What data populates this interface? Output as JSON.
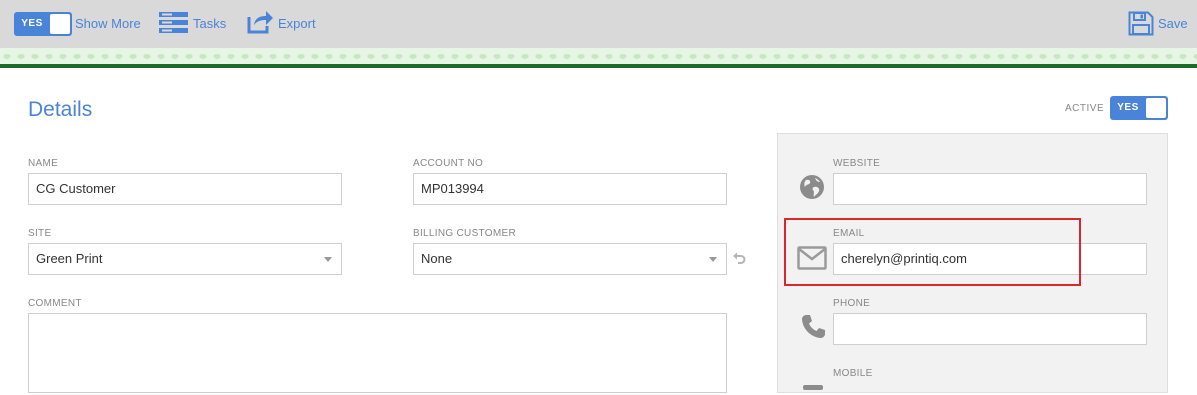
{
  "toolbar": {
    "show_more_toggle": "YES",
    "show_more_label": "Show More",
    "tasks_label": "Tasks",
    "export_label": "Export",
    "save_label": "Save",
    "icons": {
      "tasks": "list-icon",
      "export": "export-arrow-icon",
      "save": "floppy-disk-icon"
    }
  },
  "details": {
    "title": "Details",
    "active_label": "ACTIVE",
    "active_toggle": "YES"
  },
  "form": {
    "name": {
      "label": "NAME",
      "value": "CG Customer"
    },
    "account_no": {
      "label": "ACCOUNT NO",
      "value": "MP013994"
    },
    "site": {
      "label": "SITE",
      "value": "Green Print"
    },
    "billing_customer": {
      "label": "BILLING CUSTOMER",
      "value": "None"
    },
    "comment": {
      "label": "COMMENT",
      "value": ""
    }
  },
  "contact": {
    "website": {
      "label": "WEBSITE",
      "value": "",
      "icon": "globe-icon"
    },
    "email": {
      "label": "EMAIL",
      "value": "cherelyn@printiq.com",
      "icon": "envelope-icon"
    },
    "phone": {
      "label": "PHONE",
      "value": "",
      "icon": "phone-icon"
    },
    "mobile": {
      "label": "MOBILE",
      "icon": "mobile-icon"
    }
  },
  "colors": {
    "accent": "#4a84d9",
    "toolbar_bg": "#d9d9d9",
    "stripe_green": "#1e6a2a",
    "highlight_red": "#d9272d"
  }
}
